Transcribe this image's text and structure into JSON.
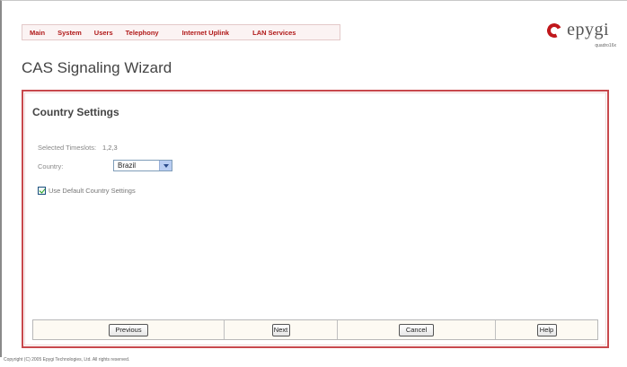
{
  "nav": {
    "items": [
      "Main",
      "System",
      "Users",
      "Telephony",
      "Internet Uplink",
      "LAN Services"
    ]
  },
  "logo": {
    "brand": "epygi",
    "product": "quadro16x",
    "icon": "epygi-c-logo-icon",
    "color": "#c0181c"
  },
  "page": {
    "title": "CAS Signaling Wizard"
  },
  "panel": {
    "section_title": "Country Settings",
    "timeslots_label": "Selected Timeslots:",
    "timeslots_value": "1,2,3",
    "country_label": "Country:",
    "country_value": "Brazil",
    "use_default_label": "Use Default Country Settings",
    "use_default_checked": true,
    "border_color": "#c8484c"
  },
  "buttons": {
    "previous": "Previous",
    "next": "Next",
    "cancel": "Cancel",
    "help": "Help"
  },
  "footer": {
    "copyright": "Copyright (C) 2005 Epygi Technologies, Ltd. All rights reserved."
  }
}
